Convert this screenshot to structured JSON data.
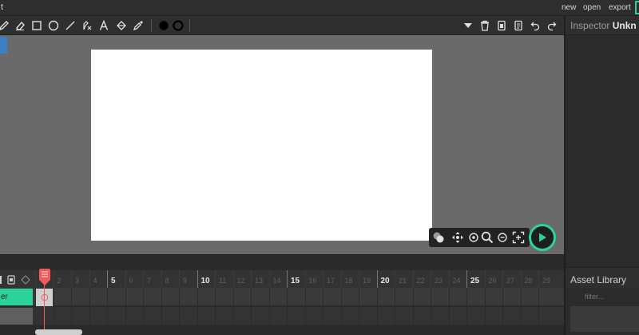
{
  "menubar": {
    "title": "t",
    "items": [
      "new",
      "open",
      "export"
    ]
  },
  "toolbar": {
    "tools": [
      "pencil-icon",
      "eraser-icon",
      "rectangle-icon",
      "ellipse-icon",
      "line-icon",
      "path-tool-icon",
      "text-icon",
      "fill-bucket-icon",
      "eyedropper-icon"
    ],
    "colors": {
      "fill": "#000000",
      "stroke": "#000000"
    },
    "actions": [
      "dropdown-arrow-icon",
      "trash-icon",
      "copy-icon",
      "paste-icon",
      "undo-icon",
      "redo-icon"
    ]
  },
  "inspector": {
    "label": "Inspector",
    "selection": "Unkn"
  },
  "asset_library": {
    "label": "Asset Library",
    "filter_placeholder": "filter..."
  },
  "timeline": {
    "layer_name": "er",
    "frame_labels": [
      "5",
      "10",
      "15",
      "20",
      "25"
    ],
    "minor_labels": [
      "2",
      "3",
      "4",
      "6",
      "7",
      "8",
      "9",
      "11",
      "12",
      "13",
      "14",
      "16",
      "17",
      "18",
      "19",
      "21",
      "22",
      "23",
      "24",
      "26",
      "27",
      "28",
      "29"
    ],
    "current_frame": 1
  },
  "theme": {
    "accent": "#2bd39a",
    "playhead": "#ef5b5b",
    "stage": "#ffffff",
    "workspace": "#6a6a6a"
  }
}
